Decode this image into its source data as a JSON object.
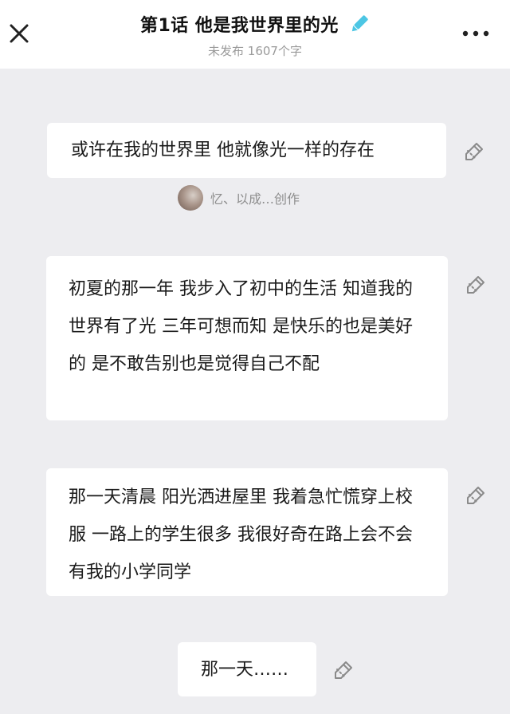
{
  "header": {
    "title": "第1话  他是我世界里的光",
    "subtitle": "未发布 1607个字",
    "close_icon": "close-icon",
    "edit_icon": "pencil-icon",
    "more_icon": "more-dots-icon",
    "accent_color": "#4cc6e4"
  },
  "paragraphs": [
    {
      "text": "或许在我的世界里 他就像光一样的存在",
      "edit_icon": "edit-pen-icon"
    },
    {
      "text": "初夏的那一年 我步入了初中的生活 知道我的世界有了光 三年可想而知 是快乐的也是美好的 是不敢告别也是觉得自己不配",
      "edit_icon": "edit-pen-icon"
    },
    {
      "text": "那一天清晨 阳光洒进屋里 我着急忙慌穿上校服 一路上的学生很多 我很好奇在路上会不会有我的小学同学",
      "edit_icon": "edit-pen-icon"
    },
    {
      "text": "那一天……",
      "edit_icon": "edit-pen-icon"
    }
  ],
  "author": {
    "label": "忆、以成…创作"
  }
}
